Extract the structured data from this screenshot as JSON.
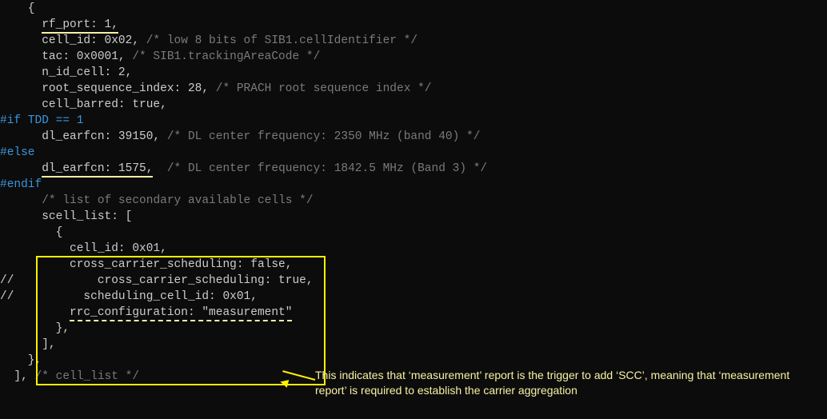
{
  "code": {
    "l01": "    {",
    "l02a": "      ",
    "l02b": "rf_port: 1,",
    "l03a": "      cell_id: 0x02, ",
    "l03b": "/* low 8 bits of SIB1.cellIdentifier */",
    "l04a": "      tac: 0x0001, ",
    "l04b": "/* SIB1.trackingAreaCode */",
    "l05": "      n_id_cell: 2,",
    "l06a": "      root_sequence_index: 28, ",
    "l06b": "/* PRACH root sequence index */",
    "l07": "      cell_barred: true,",
    "l08": "",
    "l09": "#if TDD == 1",
    "l10a": "      dl_earfcn: 39150, ",
    "l10b": "/* DL center frequency: 2350 MHz (band 40) */",
    "l11": "#else",
    "l12a": "      ",
    "l12b": "dl_earfcn: 1575,",
    "l12c": "  ",
    "l12d": "/* DL center frequency: 1842.5 MHz (Band 3) */",
    "l13": "#endif",
    "l14": "",
    "l15a": "      ",
    "l15b": "/* list of secondary available cells */",
    "l16": "      scell_list: [",
    "l17": "        {",
    "l18": "          cell_id: 0x01,",
    "l19": "          cross_carrier_scheduling: false,",
    "l20": "//            cross_carrier_scheduling: true,",
    "l21": "//          scheduling_cell_id: 0x01,",
    "l22a": "          ",
    "l22b": "rrc_configuration: \"measurement\"",
    "l23": "        },",
    "l24": "      ],",
    "l25": "    },",
    "l26a": "  ], ",
    "l26b": "/* cell_list */"
  },
  "annotation": "This indicates that ‘measurement’ report is the trigger to add ‘SCC’, meaning that ‘measurement report’ is required to establish the carrier aggregation"
}
